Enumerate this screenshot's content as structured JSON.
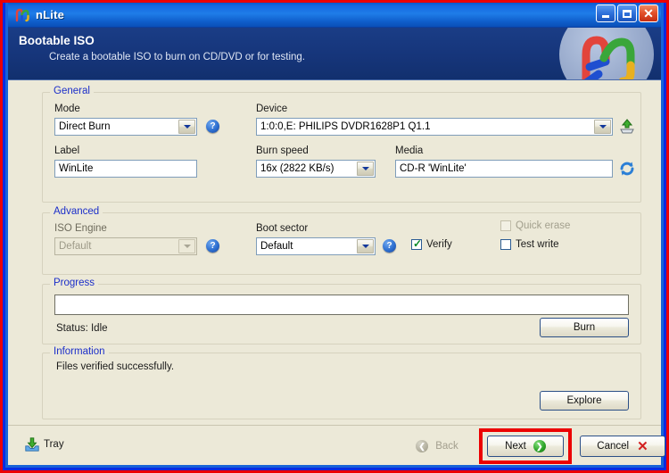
{
  "window": {
    "title": "nLite",
    "icon": "nlite-logo-icon",
    "minimize_label": "_",
    "maximize_label": "□",
    "close_label": "X"
  },
  "banner": {
    "title": "Bootable ISO",
    "subtitle": "Create a bootable ISO to burn on CD/DVD or for testing.",
    "logo": "nlite-logo-icon"
  },
  "general": {
    "legend": "General",
    "mode_label": "Mode",
    "mode_value": "Direct Burn",
    "mode_help": "?",
    "device_label": "Device",
    "device_value": "1:0:0,E: PHILIPS  DVDR1628P1      Q1.1",
    "eject_icon": "eject-icon",
    "label_label": "Label",
    "label_value": "WinLite",
    "burn_speed_label": "Burn speed",
    "burn_speed_value": "16x (2822 KB/s)",
    "media_label": "Media",
    "media_value": "CD-R 'WinLite'",
    "refresh_icon": "refresh-icon"
  },
  "advanced": {
    "legend": "Advanced",
    "iso_engine_label": "ISO Engine",
    "iso_engine_value": "Default",
    "iso_engine_help": "?",
    "boot_sector_label": "Boot sector",
    "boot_sector_value": "Default",
    "boot_sector_help": "?",
    "verify_label": "Verify",
    "verify_checked": true,
    "quick_erase_label": "Quick erase",
    "quick_erase_checked": false,
    "test_write_label": "Test write",
    "test_write_checked": false
  },
  "progress": {
    "legend": "Progress",
    "value": 0,
    "status_text": "Status: Idle",
    "burn_label": "Burn"
  },
  "information": {
    "legend": "Information",
    "message": "Files verified successfully.",
    "explore_label": "Explore"
  },
  "footer": {
    "tray_label": "Tray",
    "tray_icon": "tray-down-arrow-icon",
    "back_label": "Back",
    "next_label": "Next",
    "cancel_label": "Cancel"
  },
  "colors": {
    "accent_blue": "#1b2ec9",
    "titlebar_blue": "#1467e0",
    "banner_blue": "#16357a",
    "surface": "#ece9d8",
    "highlight_red": "#ec0000",
    "arrow_green": "#2fa62a"
  }
}
